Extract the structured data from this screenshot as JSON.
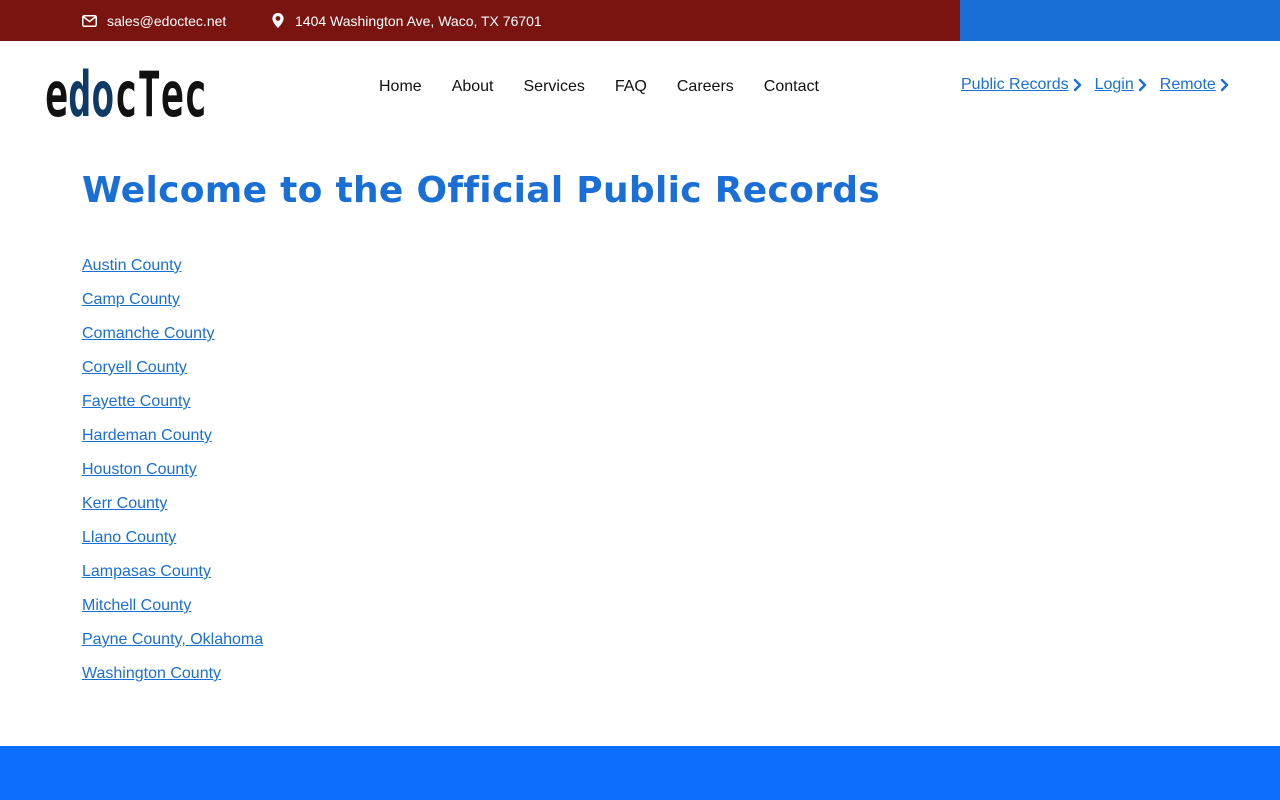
{
  "topbar": {
    "email": "sales@edoctec.net",
    "address": "1404 Washington Ave, Waco, TX 76701",
    "left_color": "#7a1410",
    "right_color": "#1a6fd6",
    "email_icon": "envelope-icon",
    "address_icon": "map-pin-icon"
  },
  "logo": {
    "text": "edocTec",
    "dark_color": "#111111",
    "accent_color": "#0e3a66"
  },
  "nav": {
    "items": [
      {
        "label": "Home"
      },
      {
        "label": "About"
      },
      {
        "label": "Services"
      },
      {
        "label": "FAQ"
      },
      {
        "label": "Careers"
      },
      {
        "label": "Contact"
      }
    ]
  },
  "portal_links": [
    {
      "label": "Public Records",
      "icon": "chevron-right-icon"
    },
    {
      "label": "Login",
      "icon": "chevron-right-icon"
    },
    {
      "label": "Remote",
      "icon": "chevron-right-icon"
    }
  ],
  "main": {
    "title": "Welcome to the Official Public Records",
    "counties": [
      "Austin County",
      "Camp County",
      "Comanche County",
      "Coryell County",
      "Fayette County",
      "Hardeman County",
      "Houston County",
      "Kerr County",
      "Llano County",
      "Lampasas County",
      "Mitchell County",
      "Payne County, Oklahoma",
      "Washington County"
    ]
  },
  "colors": {
    "link": "#1a6fd6",
    "footer": "#0d6efd"
  }
}
